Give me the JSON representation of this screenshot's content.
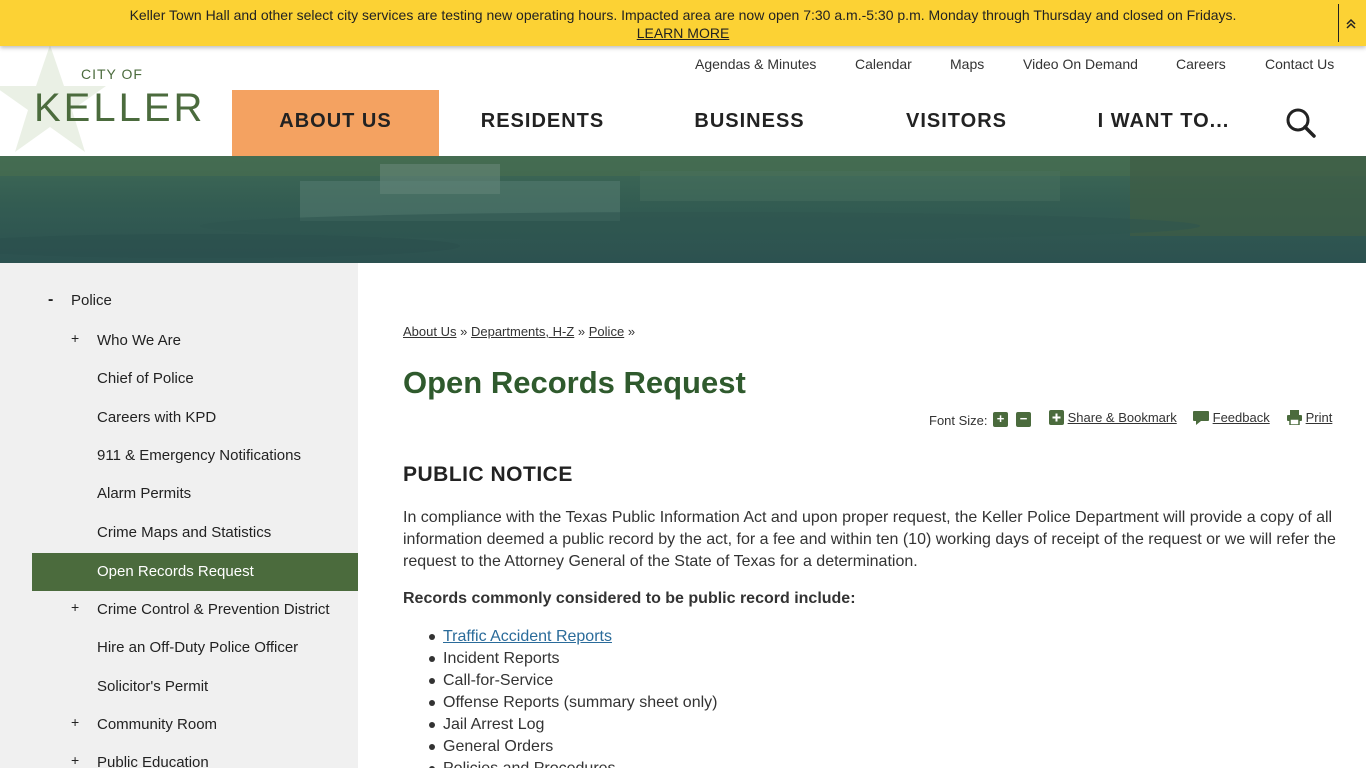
{
  "alert": {
    "message": "Keller Town Hall and other select city services are testing new operating hours. Impacted area are now open 7:30 a.m.-5:30 p.m. Monday through Thursday and closed on Fridays.",
    "link": "LEARN MORE",
    "toggle_icon": "double-chevron-up-icon"
  },
  "logo": {
    "city": "CITY OF",
    "name": "KELLER",
    "icon": "star-icon"
  },
  "util_nav": [
    "Agendas & Minutes",
    "Calendar",
    "Maps",
    "Video On Demand",
    "Careers",
    "Contact Us"
  ],
  "main_nav": [
    {
      "label": "ABOUT US",
      "active": true
    },
    {
      "label": "RESIDENTS",
      "active": false
    },
    {
      "label": "BUSINESS",
      "active": false
    },
    {
      "label": "VISITORS",
      "active": false
    },
    {
      "label": "I WANT TO...",
      "active": false
    }
  ],
  "search_icon": "search-icon",
  "sidebar": {
    "items": [
      {
        "label": "Police",
        "expander": "-",
        "level": "top",
        "active": false
      },
      {
        "label": "Who We Are",
        "expander": "+",
        "level": "sub",
        "active": false
      },
      {
        "label": "Chief of Police",
        "expander": "",
        "level": "sub",
        "active": false
      },
      {
        "label": "Careers with KPD",
        "expander": "",
        "level": "sub",
        "active": false
      },
      {
        "label": "911 & Emergency Notifications",
        "expander": "",
        "level": "sub",
        "active": false
      },
      {
        "label": "Alarm Permits",
        "expander": "",
        "level": "sub",
        "active": false
      },
      {
        "label": "Crime Maps and Statistics",
        "expander": "",
        "level": "sub",
        "active": false
      },
      {
        "label": "Open Records Request",
        "expander": "",
        "level": "sub",
        "active": true
      },
      {
        "label": "Crime Control & Prevention District",
        "expander": "+",
        "level": "sub",
        "active": false
      },
      {
        "label": "Hire an Off-Duty Police Officer",
        "expander": "",
        "level": "sub",
        "active": false
      },
      {
        "label": "Solicitor's Permit",
        "expander": "",
        "level": "sub",
        "active": false
      },
      {
        "label": "Community Room",
        "expander": "+",
        "level": "sub",
        "active": false
      },
      {
        "label": "Public Education",
        "expander": "+",
        "level": "sub",
        "active": false
      }
    ]
  },
  "breadcrumb": [
    "About Us",
    "Departments, H-Z",
    "Police"
  ],
  "breadcrumb_sep": "»",
  "page_title": "Open Records Request",
  "tools": {
    "font_size_label": "Font Size:",
    "increase": "+",
    "decrease": "−",
    "share_icon": "plus-square-icon",
    "share": "Share & Bookmark",
    "feedback_icon": "speech-bubble-icon",
    "feedback": "Feedback",
    "print_icon": "printer-icon",
    "print": "Print"
  },
  "notice_heading": "PUBLIC NOTICE",
  "notice_paragraph": "In compliance with the Texas Public Information Act and upon proper request, the Keller Police Department will provide a copy of all information deemed a public record by the act, for a fee and within ten (10) working days of receipt of the request or we will refer the request to the Attorney General of the State of Texas for a determination.",
  "records_intro": "Records commonly considered to be public record include:",
  "records": [
    {
      "label": "Traffic Accident Reports",
      "link": true
    },
    {
      "label": "Incident Reports",
      "link": false
    },
    {
      "label": "Call-for-Service",
      "link": false
    },
    {
      "label": "Offense Reports (summary sheet only)",
      "link": false
    },
    {
      "label": "Jail Arrest Log",
      "link": false
    },
    {
      "label": "General Orders",
      "link": false
    },
    {
      "label": "Policies and Procedures",
      "link": false
    }
  ],
  "colors": {
    "alert_bg": "#fcd234",
    "brand_green": "#4b6b3d",
    "title_green": "#2f5a2d",
    "nav_active": "#f4a261",
    "sidebar_bg": "#f0f0f0",
    "link_blue": "#2a6b9a"
  }
}
